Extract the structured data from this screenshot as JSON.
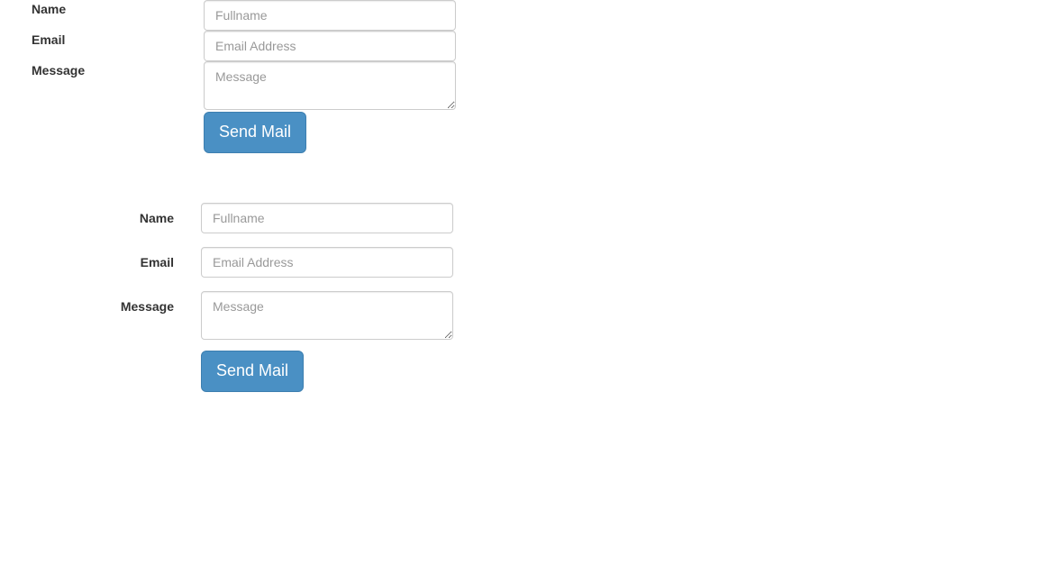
{
  "theme": {
    "button_bg": "#4a90c4",
    "button_border": "#3d7fb0",
    "button_text": "#ffffff",
    "input_border": "#cccccc",
    "placeholder_color": "#999999",
    "label_color": "#333333",
    "page_bg": "#ffffff"
  },
  "forms": [
    {
      "id": "contact-form-compact",
      "layout": "compact-left-labels",
      "fields": [
        {
          "name": "name",
          "label": "Name",
          "type": "text",
          "placeholder": "Fullname",
          "value": ""
        },
        {
          "name": "email",
          "label": "Email",
          "type": "email",
          "placeholder": "Email Address",
          "value": ""
        },
        {
          "name": "message",
          "label": "Message",
          "type": "textarea",
          "placeholder": "Message",
          "value": ""
        }
      ],
      "submit_label": "Send Mail"
    },
    {
      "id": "contact-form-horizontal",
      "layout": "horizontal-right-labels",
      "fields": [
        {
          "name": "name",
          "label": "Name",
          "type": "text",
          "placeholder": "Fullname",
          "value": ""
        },
        {
          "name": "email",
          "label": "Email",
          "type": "email",
          "placeholder": "Email Address",
          "value": ""
        },
        {
          "name": "message",
          "label": "Message",
          "type": "textarea",
          "placeholder": "Message",
          "value": ""
        }
      ],
      "submit_label": "Send Mail"
    }
  ]
}
